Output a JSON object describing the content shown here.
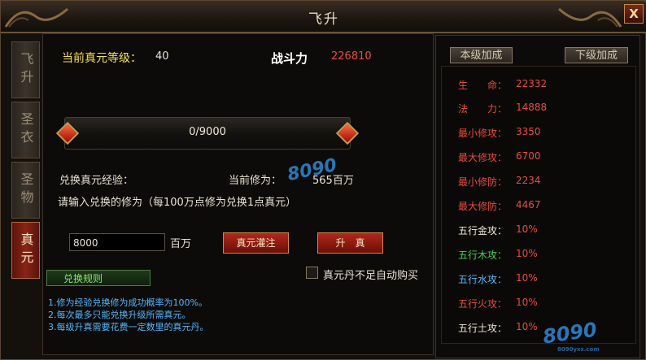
{
  "window": {
    "title": "飞升",
    "close": "X"
  },
  "tabs": [
    {
      "label": "飞升",
      "active": false
    },
    {
      "label": "圣衣",
      "active": false
    },
    {
      "label": "圣物",
      "active": false
    },
    {
      "label": "真元",
      "active": true
    }
  ],
  "main": {
    "level_label": "当前真元等级：",
    "level_value": "40",
    "power_label": "战斗力",
    "power_value": "226810",
    "progress_text": "0/9000",
    "progress_fraction": 0,
    "exchange_label": "兑换真元经验：",
    "current_cultivation_label": "当前修为：",
    "current_cultivation_value": "565百万",
    "prompt": "请输入兑换的修为（每100万点修为兑换1点真元）",
    "input_value": "8000",
    "input_unit": "百万",
    "inject_button": "真元灌注",
    "ascend_button": "升　真",
    "auto_buy_label": "真元丹不足自动购买",
    "rules_button": "兑换规则",
    "rules": [
      "1.修为经验兑换修为成功概率为100%。",
      "2.每次最多只能兑换升级所需真元。",
      "3.每级升真需要花费一定数里的真元丹。"
    ]
  },
  "side": {
    "tab_current": "本级加成",
    "tab_next": "下级加成",
    "stats": [
      {
        "name": "生　　命：",
        "value": "22332",
        "color": "#e84c3a"
      },
      {
        "name": "法　　力：",
        "value": "14888",
        "color": "#e84c3a"
      },
      {
        "name": "最小修攻：",
        "value": "3350",
        "color": "#e84c3a"
      },
      {
        "name": "最大修攻：",
        "value": "6700",
        "color": "#e84c3a"
      },
      {
        "name": "最小修防：",
        "value": "2234",
        "color": "#e84c3a"
      },
      {
        "name": "最大修防：",
        "value": "4467",
        "color": "#e84c3a"
      },
      {
        "name": "五行金攻：",
        "value": "10%",
        "color": "#f0ead8"
      },
      {
        "name": "五行木攻：",
        "value": "10%",
        "color": "#3ecf4a"
      },
      {
        "name": "五行水攻：",
        "value": "10%",
        "color": "#4fb8ff"
      },
      {
        "name": "五行火攻：",
        "value": "10%",
        "color": "#e84c3a"
      },
      {
        "name": "五行土攻：",
        "value": "10%",
        "color": "#e8e2d4"
      }
    ]
  },
  "watermark": {
    "text": "8090",
    "sub": "8090yxs.com"
  }
}
